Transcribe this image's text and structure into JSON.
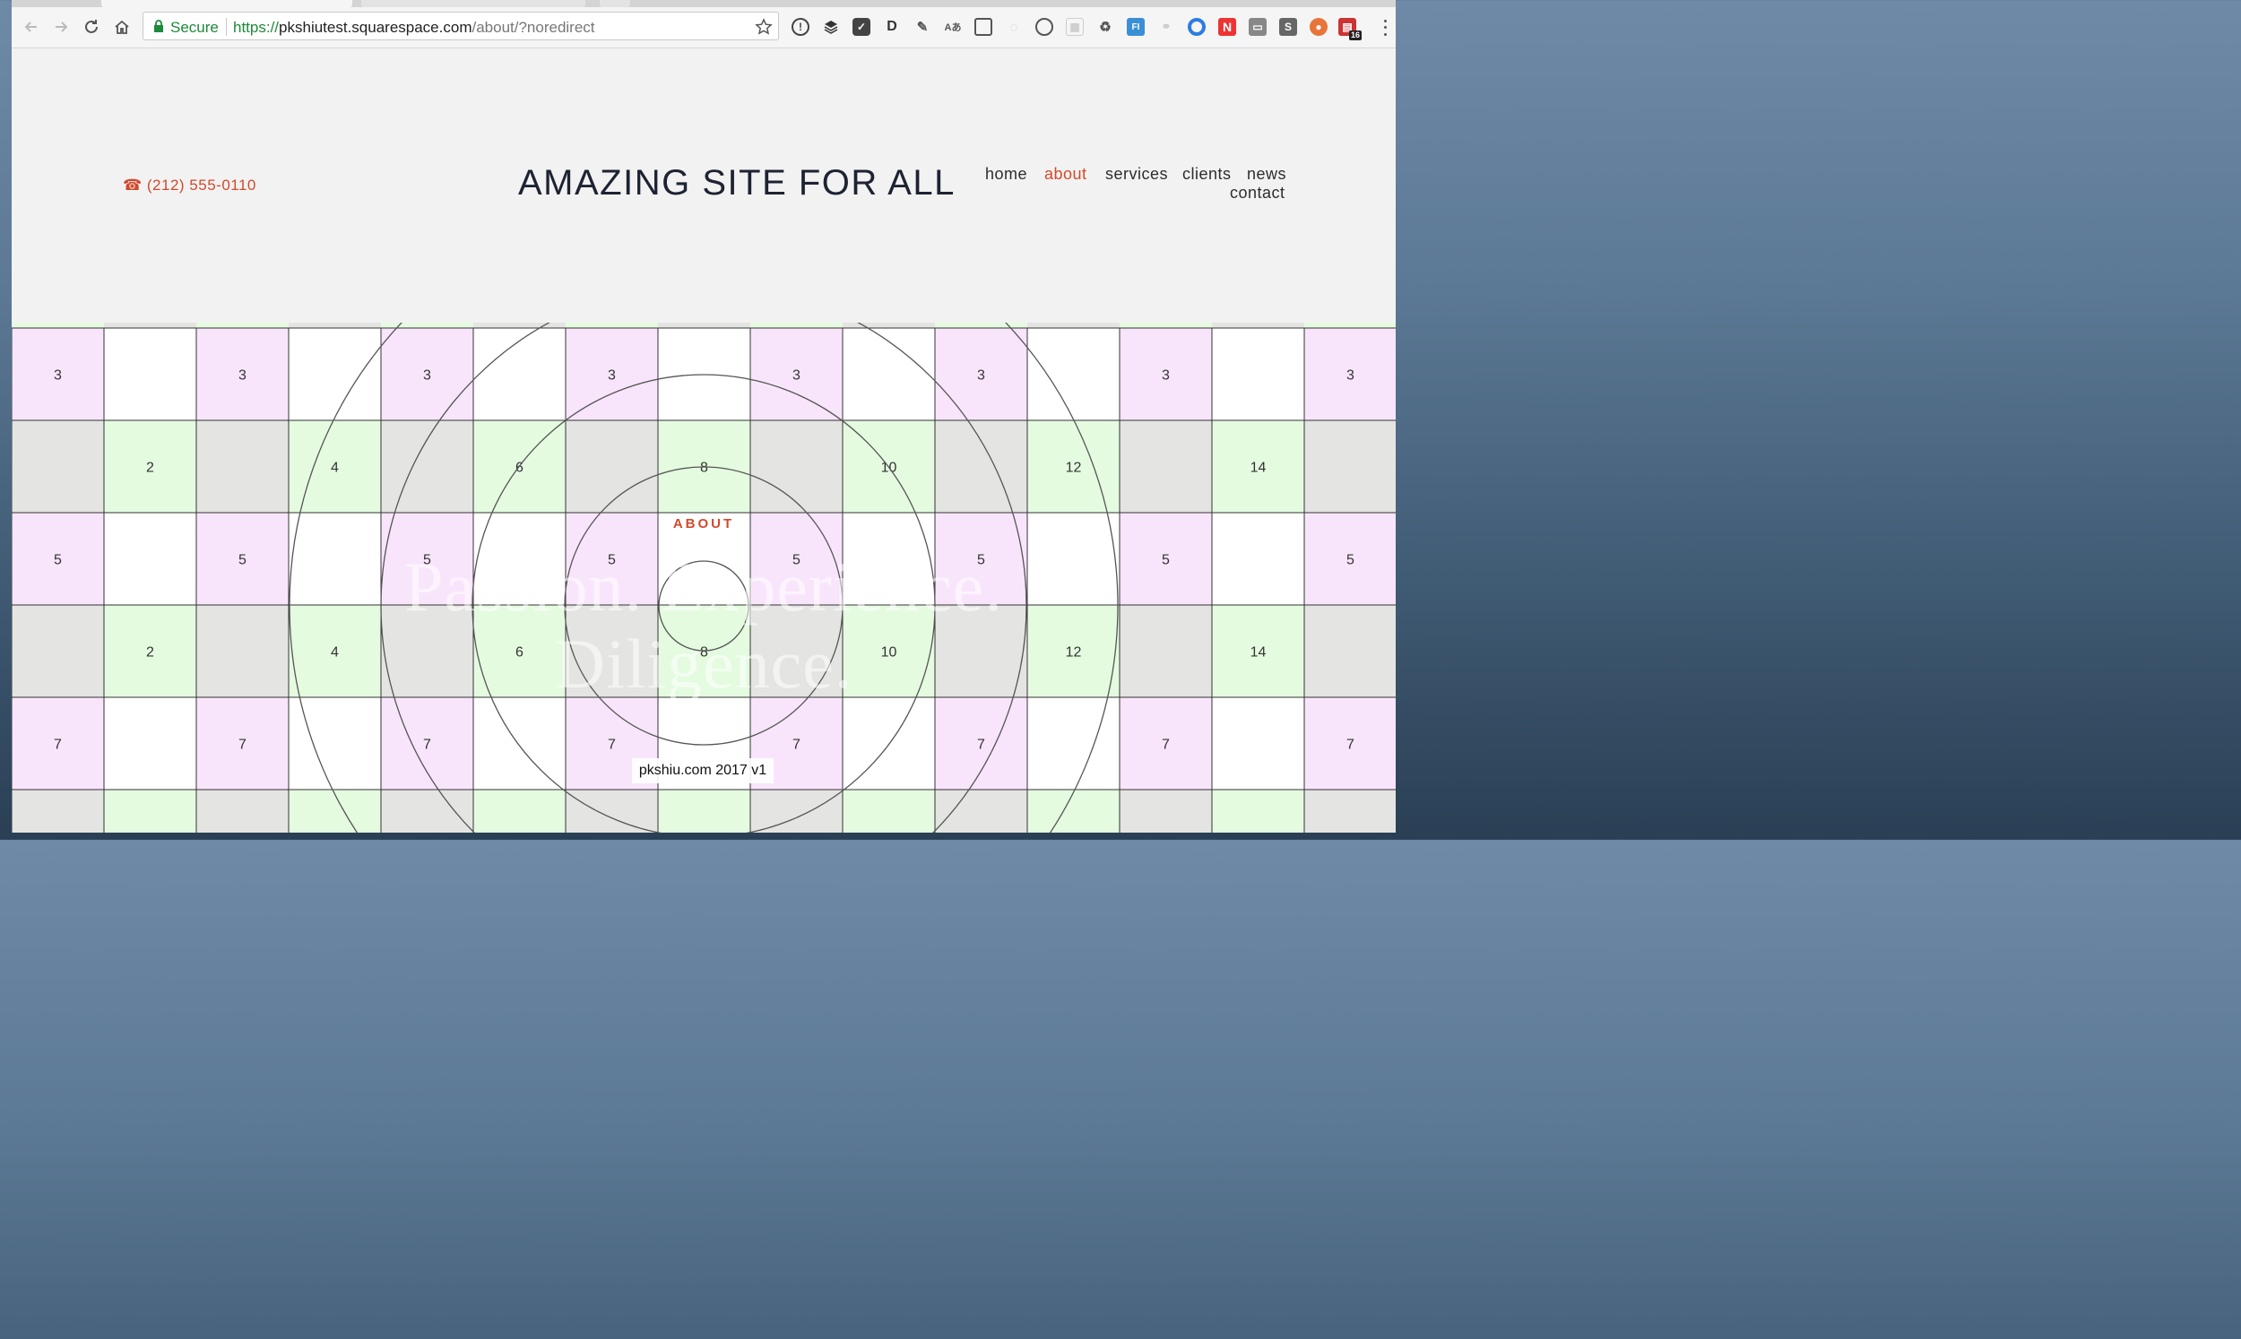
{
  "browser": {
    "secure_label": "Secure",
    "url_protocol": "https://",
    "url_host": "pkshiutest.squarespace.com",
    "url_path": "/about/?noredirect",
    "extension_badge": "16"
  },
  "header": {
    "phone": "☎ (212) 555-0110",
    "site_title": "AMAZING SITE FOR ALL",
    "nav": [
      "home",
      "about",
      "services",
      "clients",
      "news",
      "contact"
    ],
    "active_nav": "about",
    "accent_color": "#d24a2c"
  },
  "hero": {
    "section_label": "ABOUT",
    "tagline_line1": "Passion. Experience.",
    "tagline_line2": "Diligence.",
    "credit": "pkshiu.com 2017 v1",
    "grid": {
      "row_labels": [
        {
          "pattern": "odd",
          "value": "3"
        },
        {
          "pattern": "even",
          "values": [
            "2",
            "4",
            "6",
            "8",
            "10",
            "12",
            "14"
          ]
        },
        {
          "pattern": "odd",
          "value": "5"
        },
        {
          "pattern": "even",
          "values": [
            "2",
            "4",
            "6",
            "8",
            "10",
            "12",
            "14"
          ]
        },
        {
          "pattern": "odd",
          "value": "7"
        }
      ],
      "colors": {
        "purple": "#f8e5fb",
        "green": "#e4fbe0",
        "gray": "#e4e5e3",
        "white": "#ffffff"
      }
    }
  }
}
